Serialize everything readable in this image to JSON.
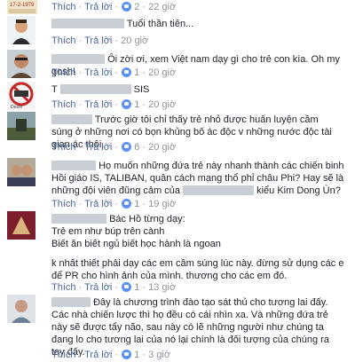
{
  "actions": {
    "like": "Thích",
    "reply": "Trả lời",
    "dot": "·"
  },
  "top_action": {
    "like_count": "2",
    "time": "22 giờ"
  },
  "comments": [
    {
      "text": "Tuổi thần tiên...",
      "like_count": "",
      "time": "20 giờ"
    },
    {
      "text": "Ôi zời ơi, xem Việt nam dạy gì cho trẻ con kìa. Oh my gosh!",
      "like_count": "1",
      "time": "20 giờ"
    },
    {
      "text": "SIS",
      "prefix": "T",
      "like_count": "1",
      "time": "20 giờ"
    },
    {
      "text": "Trước giờ tôi chỉ thấy trẻ nhỏ được huấn luyện cầm súng ở những nơi có bọn khủng bố ác độc v những nước độc tài gian ác thôi.",
      "like_count": "6",
      "time": "20 giờ"
    },
    {
      "text": "Họ muốn những đứa trẻ này nhanh thành các chiến binh Hồi giáo IS, TALIBAN, quân cách mạng thổ phỉ châu Phi? Hay sẽ là những đội viên đũng cảm của",
      "text_end": "kiểu Kim Dong Ùn?",
      "like_count": "1",
      "time": "19 giờ"
    },
    {
      "text": "Bác Hồ từng dạy:",
      "lines": [
        "Trẻ em như búp trên cành",
        "Biết ăn biết ngủ biết học hành là ngoan",
        "k nhất thiết phải dạy các em cầm súng lúc này. đừng sử dụng các e để PR cho hình ảnh của mình. thương cho các em đó."
      ],
      "like_count": "1",
      "time": "13 giờ"
    },
    {
      "text": "Đây là chương trình đào tạo sát thủ cho tương lai đấy. Các nhà chiến lược thì họ đều có cái nhìn xa. Và những đứa trẻ này sẽ được tẩy não, sau này có lẽ những người như chúng ta đang lo cho tương lai của nó lại chính là đối tượng của chúng ra tay đấy.",
      "like_count": "1",
      "time": "3 giờ"
    }
  ],
  "avatar3_caption": "Dosol"
}
